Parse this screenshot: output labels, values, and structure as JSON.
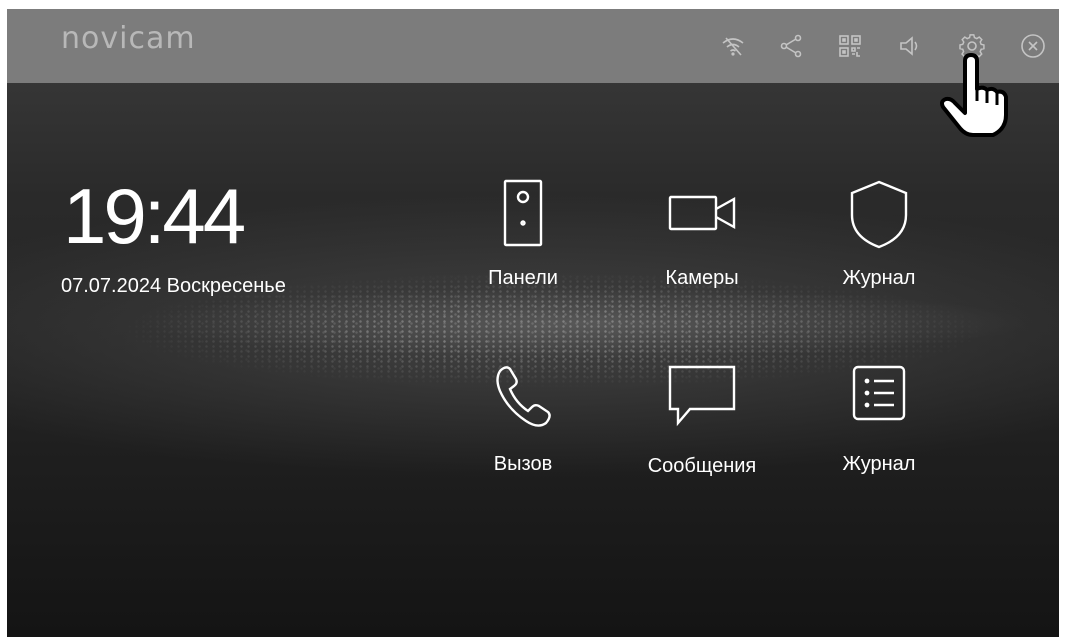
{
  "brand": {
    "logo_text": "novicam"
  },
  "topbar": {
    "icons": [
      "wifi-off-icon",
      "share-icon",
      "qr-code-icon",
      "volume-icon",
      "gear-icon",
      "close-icon"
    ]
  },
  "clock": {
    "time": "19:44",
    "date": "07.07.2024 Воскресенье"
  },
  "tiles": [
    {
      "label": "Панели",
      "icon": "door-panel-icon"
    },
    {
      "label": "Камеры",
      "icon": "camera-icon"
    },
    {
      "label": "Журнал",
      "icon": "shield-icon"
    },
    {
      "label": "Вызов",
      "icon": "phone-icon"
    },
    {
      "label": "Сообщения",
      "icon": "message-icon"
    },
    {
      "label": "Журнал",
      "icon": "list-icon"
    }
  ],
  "colors": {
    "topbar": "#7c7c7c",
    "icon": "#c4c4c4",
    "text": "#ffffff"
  }
}
